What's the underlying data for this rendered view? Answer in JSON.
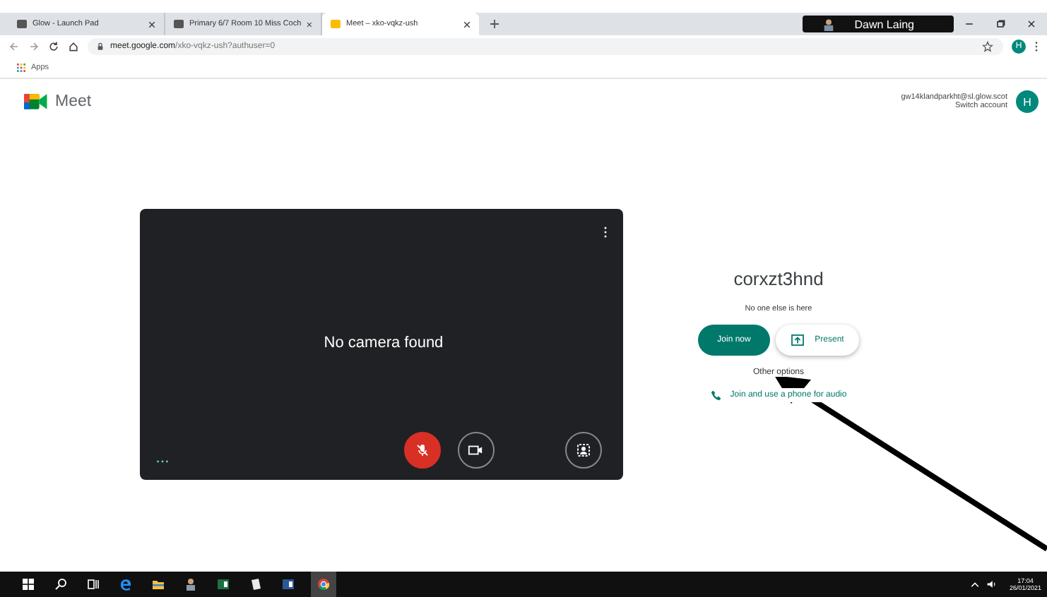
{
  "tabs": [
    {
      "label": "Glow - Launch Pad",
      "selected": false
    },
    {
      "label": "Primary 6/7 Room 10 Miss Coch",
      "selected": false
    },
    {
      "label": "Meet – xko-vqkz-ush",
      "selected": true
    }
  ],
  "presenter_badge": "Dawn Laing",
  "address_bar": {
    "url_host": "meet.google.com",
    "url_path": "/xko-vqkz-ush?authuser=0",
    "profile_initial": "H"
  },
  "bookmarks": [
    "Apps"
  ],
  "header": {
    "app_name": "Meet",
    "email": "gw14klandparkht@sl.glow.scot",
    "switch_account": "Switch account",
    "avatar_initial": "H"
  },
  "preview": {
    "message": "No camera found",
    "mic_muted": true
  },
  "meeting": {
    "name": "corxzt3hnd",
    "status": "No one else is here",
    "join_button": "Join now",
    "present_button": "Present",
    "other_options": "Other options",
    "phone_audio": "Join and use a phone for audio"
  },
  "taskbar": {
    "time": "17:04",
    "date": "26/01/2021"
  }
}
